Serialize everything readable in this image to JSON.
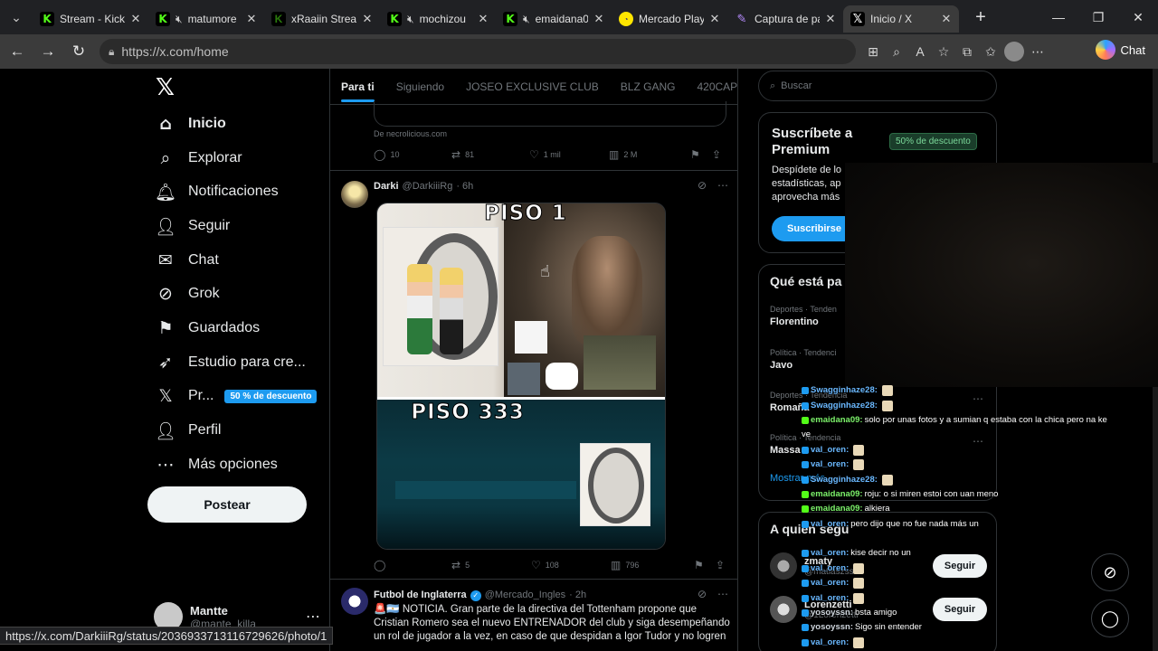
{
  "browser": {
    "tabs": [
      {
        "label": "Stream - Kick D",
        "favicon": "kick",
        "muted": false,
        "active": false
      },
      {
        "label": "matumore",
        "favicon": "kick",
        "muted": true,
        "active": false
      },
      {
        "label": "xRaaiin Stream",
        "favicon": "kick-dim",
        "muted": false,
        "active": false
      },
      {
        "label": "mochizou",
        "favicon": "kick",
        "muted": true,
        "active": false
      },
      {
        "label": "emaidana0",
        "favicon": "kick",
        "muted": true,
        "active": false
      },
      {
        "label": "Mercado Play A",
        "favicon": "mercado",
        "muted": false,
        "active": false
      },
      {
        "label": "Captura de pan",
        "favicon": "snip",
        "muted": false,
        "active": false
      },
      {
        "label": "Inicio / X",
        "favicon": "x",
        "muted": false,
        "active": true
      }
    ],
    "url": "https://x.com/home",
    "chat_label": "Chat",
    "status_url": "https://x.com/DarkiiiRg/status/2036933713116729626/photo/1"
  },
  "leftnav": {
    "items": [
      {
        "label": "Inicio",
        "icon": "home-icon"
      },
      {
        "label": "Explorar",
        "icon": "search-icon"
      },
      {
        "label": "Notificaciones",
        "icon": "bell-icon"
      },
      {
        "label": "Seguir",
        "icon": "add-user-icon"
      },
      {
        "label": "Chat",
        "icon": "mail-icon"
      },
      {
        "label": "Grok",
        "icon": "grok-icon"
      },
      {
        "label": "Guardados",
        "icon": "bookmark-icon"
      },
      {
        "label": "Estudio para cre...",
        "icon": "rocket-icon"
      },
      {
        "label": "Pr...",
        "icon": "x-icon"
      },
      {
        "label": "Perfil",
        "icon": "user-icon"
      },
      {
        "label": "Más opciones",
        "icon": "more-circle-icon"
      }
    ],
    "premium_pill": "50 % de descuento",
    "post_button": "Postear",
    "user": {
      "name": "Mantte",
      "handle": "@mante_killa"
    }
  },
  "feed": {
    "tabs": [
      "Para ti",
      "Siguiendo",
      "JOSEO EXCLUSIVE CLUB",
      "BLZ GANG",
      "420CAP"
    ],
    "prev_post": {
      "source": "De necrolicious.com",
      "replies": "10",
      "reposts": "81",
      "likes": "1 mil",
      "views": "2 M"
    },
    "post1": {
      "name": "Darki",
      "handle": "@DarkiiiRg",
      "time": "· 6h",
      "image_top_label": "PISO 1",
      "image_bottom_label": "PISO 333",
      "replies": "",
      "reposts": "5",
      "likes": "108",
      "views": "796"
    },
    "post2": {
      "name": "Futbol de Inglaterra",
      "handle": "@Mercado_Ingles",
      "time": "· 2h",
      "text": "🚨🇦🇷 NOTICIA. Gran parte de la directiva del Tottenham propone que Cristian Romero sea el nuevo ENTRENADOR del club y siga desempeñando un rol de jugador a la vez, en caso de que despidan a Igor Tudor y no logren"
    }
  },
  "sidebar": {
    "search_placeholder": "Buscar",
    "premium": {
      "title": "Suscríbete a Premium",
      "badge": "50% de descuento",
      "desc_lines": [
        "Despídete de lo",
        "estadísticas, ap",
        "aprovecha más"
      ],
      "button": "Suscribirse"
    },
    "trends_title": "Qué está pa",
    "trends": [
      {
        "context": "Deportes · Tenden",
        "name": "Florentino"
      },
      {
        "context": "Política · Tendenci",
        "name": "Javo"
      },
      {
        "context": "Deportes · Tendencia",
        "name": "Romaña"
      },
      {
        "context": "Política · Tendencia",
        "name": "Massa"
      }
    ],
    "show_more": "Mostrar más",
    "follow_title": "A quién segu",
    "follow": [
      {
        "name": "zmaty",
        "handle": "@matiaszss",
        "button": "Seguir"
      },
      {
        "name": "Lorenzetti",
        "handle": "@1Lorenzetti",
        "button": "Seguir"
      }
    ]
  },
  "stream_chat": [
    {
      "user": "Swagginhaze28:",
      "text": "",
      "color": "blue"
    },
    {
      "user": "Swagginhaze28:",
      "text": "",
      "color": "blue"
    },
    {
      "user": "emaidana09:",
      "text": "solo por unas fotos       y a sumian q estaba con la chica pero na ke",
      "color": "green"
    },
    {
      "user": "",
      "text": "ve",
      "color": "gray"
    },
    {
      "user": "val_oren:",
      "text": "",
      "color": "blue"
    },
    {
      "user": "val_oren:",
      "text": "",
      "color": "blue"
    },
    {
      "user": "Swagginhaze28:",
      "text": "",
      "color": "blue"
    },
    {
      "user": "emaidana09:",
      "text": "roju: o si miren estoi con uan meno",
      "color": "green"
    },
    {
      "user": "emaidana09:",
      "text": "alkiera",
      "color": "green"
    },
    {
      "user": "val_oren:",
      "text": "pero dijo que no fue nada más un",
      "color": "blue"
    },
    {
      "user": "",
      "text": "",
      "color": "gray"
    },
    {
      "user": "val_oren:",
      "text": "kise decir       no un",
      "color": "blue"
    },
    {
      "user": "val_oren:",
      "text": "",
      "color": "blue"
    },
    {
      "user": "val_oren:",
      "text": "",
      "color": "blue"
    },
    {
      "user": "val_oren:",
      "text": "",
      "color": "blue"
    },
    {
      "user": "yosoyssn:",
      "text": "bsta amigo",
      "color": "gray"
    },
    {
      "user": "yosoyssn:",
      "text": "Sigo sin entender",
      "color": "gray"
    },
    {
      "user": "val_oren:",
      "text": "",
      "color": "blue"
    }
  ]
}
